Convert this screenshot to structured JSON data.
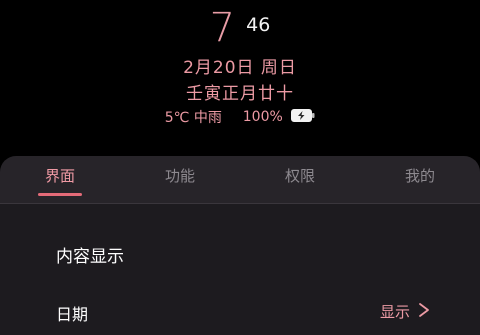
{
  "preview": {
    "clock_hour": "7",
    "clock_minute": "46",
    "date": "2月20日 周日",
    "lunar_date": "壬寅正月廿十",
    "weather": "5℃ 中雨",
    "battery": "100%",
    "accent_color": "#ec9aa4"
  },
  "tabs": [
    {
      "label": "界面",
      "active": true
    },
    {
      "label": "功能",
      "active": false
    },
    {
      "label": "权限",
      "active": false
    },
    {
      "label": "我的",
      "active": false
    }
  ],
  "content": {
    "section_title": "内容显示",
    "rows": [
      {
        "label": "日期",
        "value": "显示",
        "icon": "chevron-right-icon"
      }
    ]
  }
}
